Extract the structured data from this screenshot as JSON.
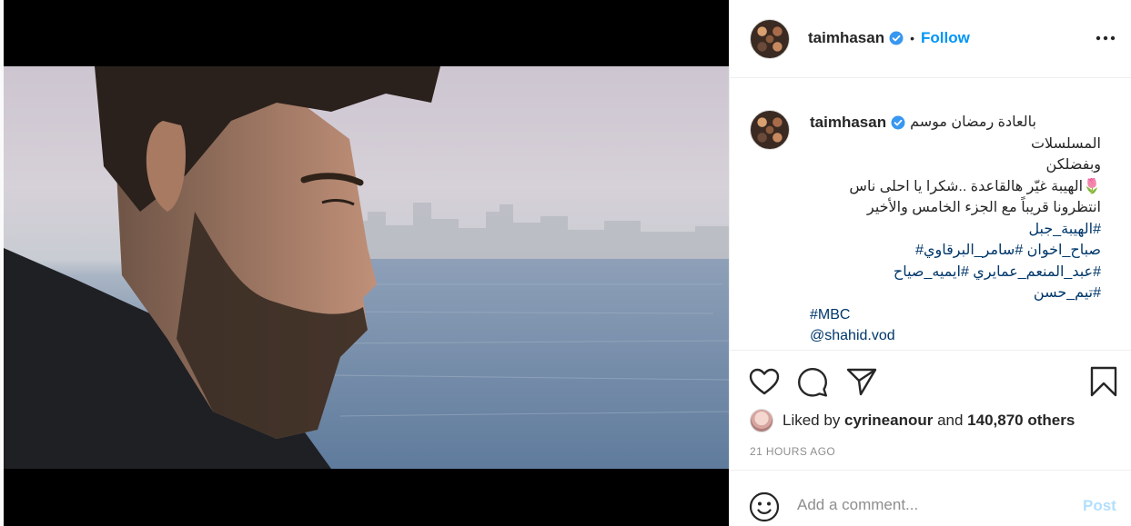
{
  "post": {
    "username": "taimhasan",
    "follow_separator": "•",
    "follow_label": "Follow",
    "more_icon": "more-horizontal-icon"
  },
  "caption": {
    "username": "taimhasan",
    "first_line": "بالعادة رمضان موسم",
    "lines": [
      {
        "text": "المسلسلات",
        "kind": "text"
      },
      {
        "text": "وبفضلكن",
        "kind": "text"
      },
      {
        "text": "🌷الهيبة غيّر هالقاعدة ..شكرا يا احلى ناس",
        "kind": "text"
      },
      {
        "text": "انتظرونا قريباً مع الجزء الخامس والأخير",
        "kind": "text"
      },
      {
        "text": "#الهيبة_جبل",
        "kind": "tag"
      },
      {
        "text": "صباح_اخوان #سامر_البرقاوي#",
        "kind": "tag"
      },
      {
        "text": "#عبد_المنعم_عمايري #ايميه_صياح",
        "kind": "tag"
      },
      {
        "text": "#تيم_حسن",
        "kind": "tag"
      },
      {
        "text": "#MBC",
        "kind": "tag-ltr"
      },
      {
        "text": "@shahid.vod",
        "kind": "tag-ltr"
      }
    ]
  },
  "actions": {
    "like_icon": "heart-icon",
    "comment_icon": "comment-icon",
    "share_icon": "share-icon",
    "save_icon": "bookmark-icon"
  },
  "likes": {
    "prefix": "Liked by ",
    "user": "cyrineanour",
    "middle": " and ",
    "count": "140,870 others"
  },
  "timestamp": "21 HOURS AGO",
  "comment": {
    "emoji_icon": "emoji-icon",
    "placeholder": "Add a comment...",
    "post_label": "Post"
  },
  "colors": {
    "accent": "#0095f6",
    "hashtag": "#00376b",
    "muted": "#8e8e8e",
    "post_disabled": "#b2dffc"
  }
}
